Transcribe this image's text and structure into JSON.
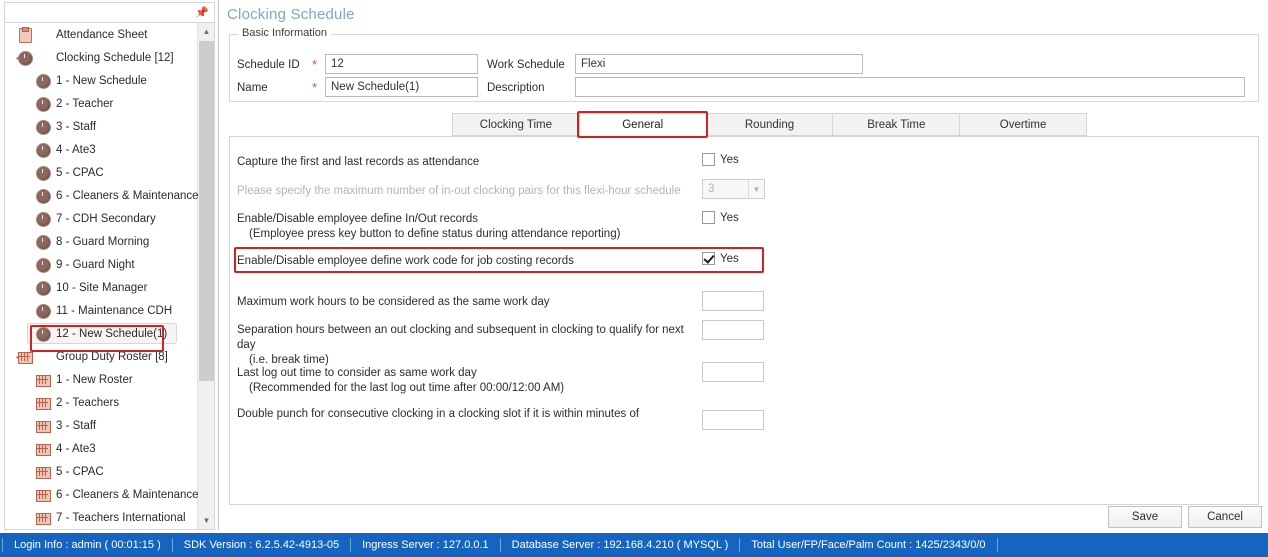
{
  "sidebar": {
    "pin_icon": "pin-icon",
    "tree": [
      {
        "level": 0,
        "icon": "clipboard-icon",
        "label": "Attendance Sheet",
        "expandable": false,
        "selected": false
      },
      {
        "level": 0,
        "icon": "clock-icon",
        "label": "Clocking Schedule [12]",
        "expandable": true,
        "selected": false
      },
      {
        "level": 1,
        "icon": "clock-icon",
        "label": "1 - New Schedule",
        "expandable": false,
        "selected": false
      },
      {
        "level": 1,
        "icon": "clock-icon",
        "label": "2 - Teacher",
        "expandable": false,
        "selected": false
      },
      {
        "level": 1,
        "icon": "clock-icon",
        "label": "3 - Staff",
        "expandable": false,
        "selected": false
      },
      {
        "level": 1,
        "icon": "clock-icon",
        "label": "4 - Ate3",
        "expandable": false,
        "selected": false
      },
      {
        "level": 1,
        "icon": "clock-icon",
        "label": "5 - CPAC",
        "expandable": false,
        "selected": false
      },
      {
        "level": 1,
        "icon": "clock-icon",
        "label": "6 - Cleaners & Maintenance",
        "expandable": false,
        "selected": false
      },
      {
        "level": 1,
        "icon": "clock-icon",
        "label": "7 - CDH Secondary",
        "expandable": false,
        "selected": false
      },
      {
        "level": 1,
        "icon": "clock-icon",
        "label": "8 - Guard Morning",
        "expandable": false,
        "selected": false
      },
      {
        "level": 1,
        "icon": "clock-icon",
        "label": "9 - Guard Night",
        "expandable": false,
        "selected": false
      },
      {
        "level": 1,
        "icon": "clock-icon",
        "label": "10 - Site Manager",
        "expandable": false,
        "selected": false
      },
      {
        "level": 1,
        "icon": "clock-icon",
        "label": "11 - Maintenance CDH",
        "expandable": false,
        "selected": false
      },
      {
        "level": 1,
        "icon": "clock-icon",
        "label": "12 - New Schedule(1)",
        "expandable": false,
        "selected": true
      },
      {
        "level": 0,
        "icon": "roster-icon",
        "label": "Group Duty Roster [8]",
        "expandable": true,
        "selected": false
      },
      {
        "level": 1,
        "icon": "roster-icon",
        "label": "1 - New Roster",
        "expandable": false,
        "selected": false
      },
      {
        "level": 1,
        "icon": "roster-icon",
        "label": "2 - Teachers",
        "expandable": false,
        "selected": false
      },
      {
        "level": 1,
        "icon": "roster-icon",
        "label": "3 - Staff",
        "expandable": false,
        "selected": false
      },
      {
        "level": 1,
        "icon": "roster-icon",
        "label": "4 - Ate3",
        "expandable": false,
        "selected": false
      },
      {
        "level": 1,
        "icon": "roster-icon",
        "label": "5 - CPAC",
        "expandable": false,
        "selected": false
      },
      {
        "level": 1,
        "icon": "roster-icon",
        "label": "6 - Cleaners & Maintenance",
        "expandable": false,
        "selected": false
      },
      {
        "level": 1,
        "icon": "roster-icon",
        "label": "7 - Teachers International",
        "expandable": false,
        "selected": false
      }
    ],
    "scroll_up_icon": "chevron-up-icon",
    "scroll_down_icon": "chevron-down-icon"
  },
  "main": {
    "page_title": "Clocking Schedule",
    "basic_information": {
      "legend": "Basic Information",
      "schedule_id_label": "Schedule ID",
      "schedule_id_value": "12",
      "schedule_id_required": "*",
      "name_label": "Name",
      "name_value": "New Schedule(1)",
      "name_required": "*",
      "work_schedule_label": "Work Schedule",
      "work_schedule_value": "Flexi",
      "description_label": "Description",
      "description_value": ""
    },
    "tabs": [
      {
        "label": "Clocking Time",
        "active": false
      },
      {
        "label": "General",
        "active": true
      },
      {
        "label": "Rounding",
        "active": false
      },
      {
        "label": "Break Time",
        "active": false
      },
      {
        "label": "Overtime",
        "active": false
      }
    ],
    "general_tab": {
      "options": [
        {
          "label": "Capture the first and last records as attendance",
          "control": "checkbox",
          "checked": false,
          "checkbox_label": "Yes",
          "disabled": false,
          "highlighted": false
        },
        {
          "label": "Please specify the maximum number of in-out clocking pairs for this flexi-hour schedule",
          "control": "combobox",
          "value": "3",
          "disabled": true,
          "highlighted": false
        },
        {
          "label": "Enable/Disable employee define In/Out records",
          "sublabel": "(Employee press key button to define status during attendance reporting)",
          "control": "checkbox",
          "checked": false,
          "checkbox_label": "Yes",
          "disabled": false,
          "highlighted": false
        },
        {
          "label": "Enable/Disable employee define work code for job costing records",
          "control": "checkbox",
          "checked": true,
          "checkbox_label": "Yes",
          "disabled": false,
          "highlighted": true
        }
      ],
      "numeric_fields": [
        {
          "label": "Maximum work hours to be considered as the same work day",
          "sublabel": "",
          "value": ""
        },
        {
          "label": "Separation hours between an out clocking and subsequent in clocking to qualify for next day",
          "sublabel": "(i.e. break time)",
          "value": ""
        },
        {
          "label": "Last log out time to consider as same work day",
          "sublabel": "(Recommended for the last log out time after 00:00/12:00 AM)",
          "value": ""
        },
        {
          "label": "Double punch for consecutive clocking in a clocking slot if it is within minutes of",
          "sublabel": "",
          "value": ""
        }
      ]
    },
    "save_label": "Save",
    "cancel_label": "Cancel"
  },
  "statusbar": {
    "segments": [
      "Login Info : admin ( 00:01:15 )",
      "SDK Version : 6.2.5.42-4913-05",
      "Ingress Server : 127.0.0.1",
      "Database Server : 192.168.4.210 ( MYSQL )",
      "Total User/FP/Face/Palm Count : 1425/2343/0/0"
    ]
  },
  "colors": {
    "accent_title": "#7fa7c4",
    "statusbar_bg": "#1565c0",
    "highlight_red": "#d32020",
    "required_star": "#e05050"
  }
}
